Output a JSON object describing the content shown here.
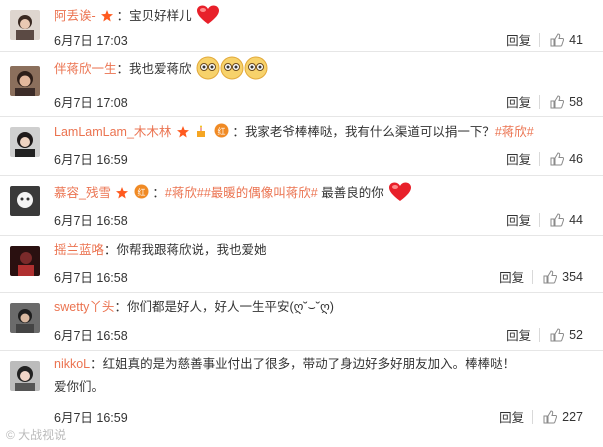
{
  "comments": [
    {
      "name": "阿丢诶-",
      "text": "：宝贝好样儿",
      "time": "6月7日 17:03",
      "likes": "41",
      "reply": "回复"
    },
    {
      "name": "伴蒋欣一生",
      "text": "：我也爱蒋欣",
      "time": "6月7日 17:08",
      "likes": "58",
      "reply": "回复"
    },
    {
      "name": "LamLamLam_木木林",
      "text": "：我家老爷棒棒哒，我有什么渠道可以捐一下？",
      "topic": "#蒋欣#",
      "time": "6月7日 16:59",
      "likes": "46",
      "reply": "回复"
    },
    {
      "name": "慕容_残雪",
      "topic1": "#蒋欣#",
      "topic2": "#最暖的偶像叫蒋欣#",
      "text": " 最善良的你",
      "time": "6月7日 16:58",
      "likes": "44",
      "reply": "回复"
    },
    {
      "name": "摇兰蓝咯",
      "text": "：你帮我跟蒋欣说，我也爱她",
      "time": "6月7日 16:58",
      "likes": "354",
      "reply": "回复"
    },
    {
      "name": "swetty丫头",
      "text": "：你们都是好人，好人一生平安(ღ˘⌣˘ღ)",
      "time": "6月7日 16:58",
      "likes": "52",
      "reply": "回复"
    },
    {
      "name": "nikkoL",
      "text": "：红姐真的是为慈善事业付出了很多，带动了身边好多好朋友加入。棒棒哒！",
      "text2": "爱你们。",
      "time": "6月7日 16:59",
      "likes": "227",
      "reply": "回复"
    }
  ],
  "watermark": "© 大战视说",
  "colors": {
    "username": "#eb7350",
    "text": "#333333",
    "divider": "#e6e6e6"
  },
  "icons": [
    "heart-icon",
    "eyes-emoji-icon",
    "thumb-up-icon",
    "star-badge-icon",
    "gold-medal-badge-icon",
    "birthday-cake-icon"
  ]
}
